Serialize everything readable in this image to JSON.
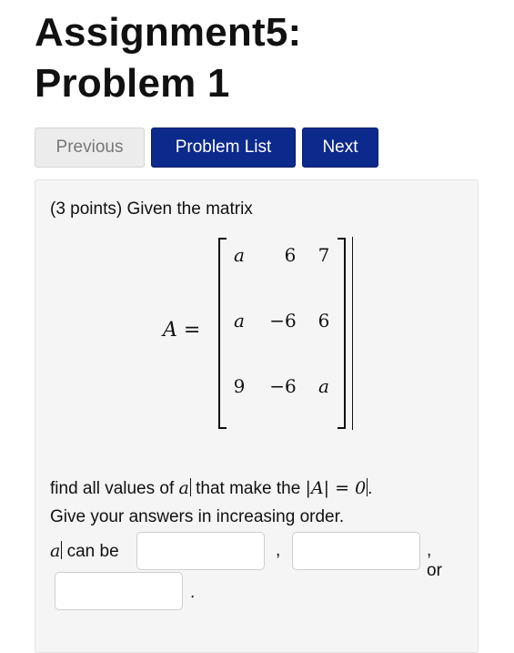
{
  "page": {
    "title_line1": "Assignment5:",
    "title_line2": "Problem 1"
  },
  "nav": {
    "previous_label": "Previous",
    "problem_list_label": "Problem List",
    "next_label": "Next"
  },
  "problem": {
    "intro": "(3 points) Given the matrix",
    "matrix_label": "A =",
    "matrix": [
      [
        "a",
        "6",
        "7"
      ],
      [
        "a",
        "−6",
        "6"
      ],
      [
        "9",
        "−6",
        "a"
      ]
    ],
    "find_prefix": "find all values of ",
    "find_var": "a",
    "find_middle": " that make the ",
    "determinant_expr": "|A| = 0",
    "find_suffix": ".",
    "order_instruction": "Give your answers in increasing order.",
    "answer_var": "a",
    "answer_label_suffix": " can be",
    "separator_1": ",",
    "separator_2": ", or",
    "end_period": ".",
    "answers": [
      "",
      "",
      ""
    ]
  },
  "colors": {
    "primary_button": "#0c2a8c",
    "secondary_button": "#ececec",
    "panel_bg": "#f5f5f5"
  }
}
